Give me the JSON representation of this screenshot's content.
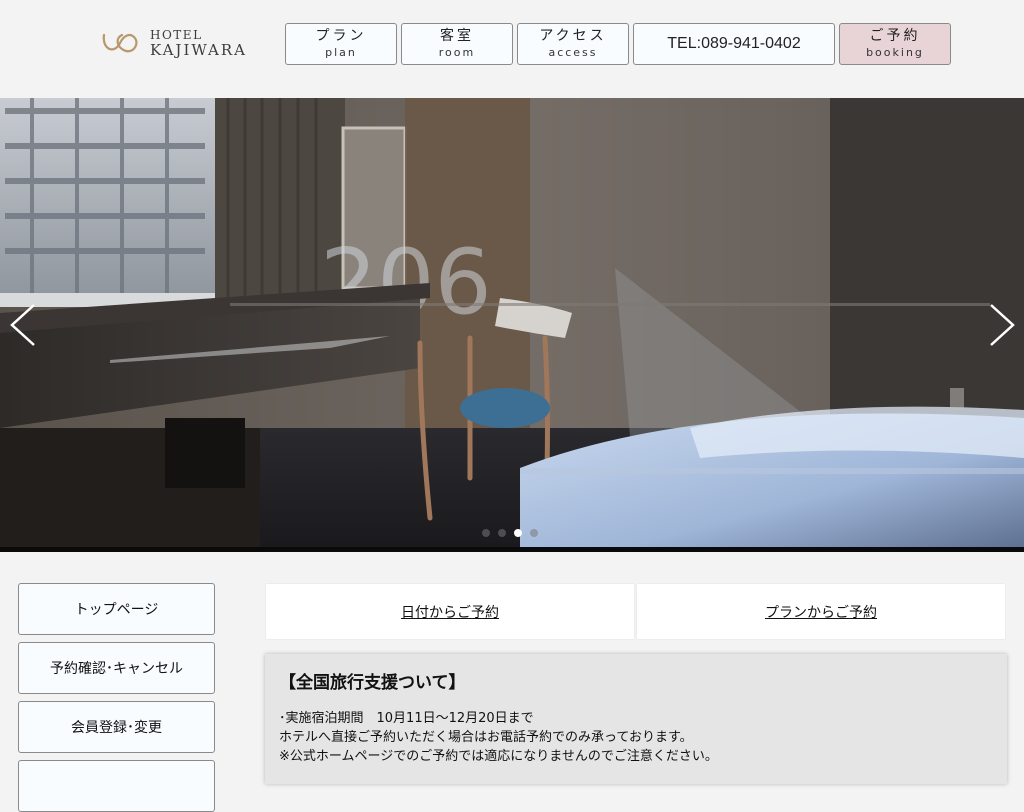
{
  "header": {
    "logo": {
      "hotel": "HOTEL",
      "name": "KAJIWARA"
    },
    "nav": {
      "plan": {
        "jp": "プラン",
        "en": "plan"
      },
      "room": {
        "jp": "客室",
        "en": "room"
      },
      "access": {
        "jp": "アクセス",
        "en": "access"
      },
      "tel": "TEL:089-941-0402",
      "booking": {
        "jp": "ご予約",
        "en": "booking"
      }
    }
  },
  "hero": {
    "room_number": "206",
    "slide_count": 4,
    "active_slide": 3
  },
  "sidebar": {
    "items": [
      {
        "label": "トップページ"
      },
      {
        "label": "予約確認･キャンセル"
      },
      {
        "label": "会員登録･変更"
      },
      {
        "label": ""
      }
    ]
  },
  "booking": {
    "by_date": "日付からご予約",
    "by_plan": "プランからご予約"
  },
  "notice": {
    "title": "【全国旅行支援ついて】",
    "lines": [
      "･実施宿泊期間　10月11日～12月20日まで",
      "ホテルへ直接ご予約いただく場合はお電話予約でのみ承っております。",
      "※公式ホームページでのご予約では適応になりませんのでご注意ください。"
    ]
  },
  "colors": {
    "page_bg": "#f3f3f3",
    "button_bg": "#f9fcff",
    "booking_bg": "#e8d3d7",
    "notice_bg": "#e5e5e5"
  }
}
